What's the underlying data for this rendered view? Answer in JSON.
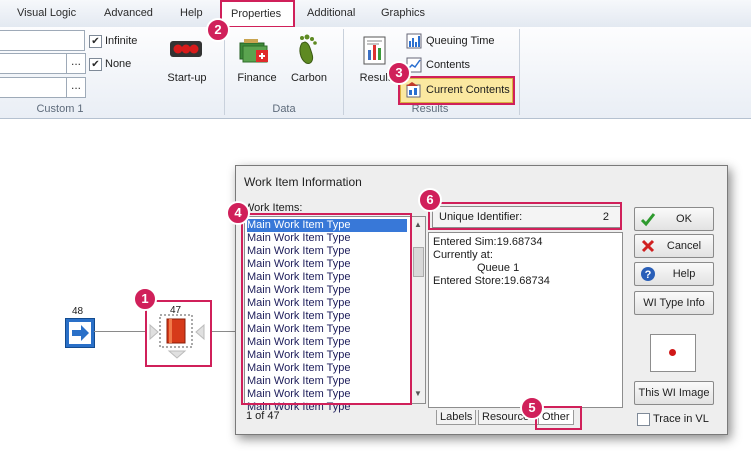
{
  "ribbon": {
    "tabs": [
      "Visual Logic",
      "Advanced",
      "Help",
      "Properties",
      "Additional",
      "Graphics"
    ],
    "checkboxes": [
      {
        "label": "Infinite",
        "checked": true
      },
      {
        "label": "None",
        "checked": true
      }
    ],
    "field_more_label": "...",
    "startup_label": "Start-up",
    "custom_group_label": "Custom 1",
    "finance_label": "Finance",
    "carbon_label": "Carbon",
    "data_group_label": "Data",
    "results_label": "Results",
    "queuing_time_label": "Queuing Time",
    "contents_label": "Contents",
    "current_contents_label": "Current Contents",
    "results_group_label": "Results"
  },
  "canvas": {
    "arrival_count": "48",
    "queue_count": "47"
  },
  "dialog": {
    "title": "Work Item Information",
    "work_items_label": "Work Items:",
    "work_items": [
      "Main Work Item Type",
      "Main Work Item Type",
      "Main Work Item Type",
      "Main Work Item Type",
      "Main Work Item Type",
      "Main Work Item Type",
      "Main Work Item Type",
      "Main Work Item Type",
      "Main Work Item Type",
      "Main Work Item Type",
      "Main Work Item Type",
      "Main Work Item Type",
      "Main Work Item Type",
      "Main Work Item Type",
      "Main Work Item Type"
    ],
    "list_status": "1 of 47",
    "unique_identifier_label": "Unique Identifier:",
    "unique_identifier_value": "2",
    "details": {
      "entered_sim": "Entered Sim:19.68734",
      "currently_at_label": "Currently at:",
      "currently_at_value": "Queue 1",
      "entered_store": "Entered Store:19.68734"
    },
    "subtabs": [
      "Labels",
      "Resources",
      "Other"
    ],
    "ok_label": "OK",
    "cancel_label": "Cancel",
    "help_label": "Help",
    "wi_type_info_label": "WI Type Info",
    "this_wi_image_label": "This WI Image",
    "trace_in_vl_label": "Trace in VL",
    "trace_checked": false
  },
  "callouts": [
    "1",
    "2",
    "3",
    "4",
    "5",
    "6"
  ],
  "colors": {
    "callout": "#d0205a",
    "highlight_fill": "#fbe8a0",
    "selection": "#3878d8",
    "queue_icon": "#d63a1a"
  }
}
